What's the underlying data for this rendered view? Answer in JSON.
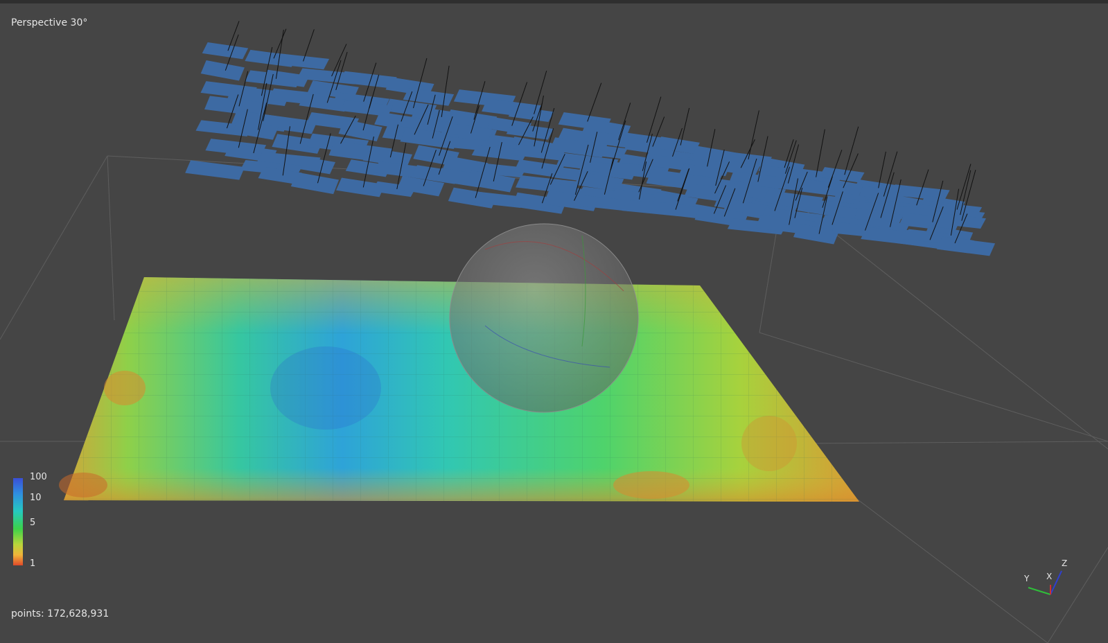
{
  "viewport": {
    "view_label": "Perspective 30°",
    "points_label": "points: 172,628,931"
  },
  "colorbar": {
    "ticks": [
      "100",
      "10",
      "5",
      "1"
    ]
  },
  "axes": {
    "x_label": "X",
    "y_label": "Y",
    "z_label": "Z"
  },
  "colors": {
    "background": "#454545",
    "plane_fill": "#3d6aa3",
    "sphere_fill": "#6e6e6e"
  }
}
